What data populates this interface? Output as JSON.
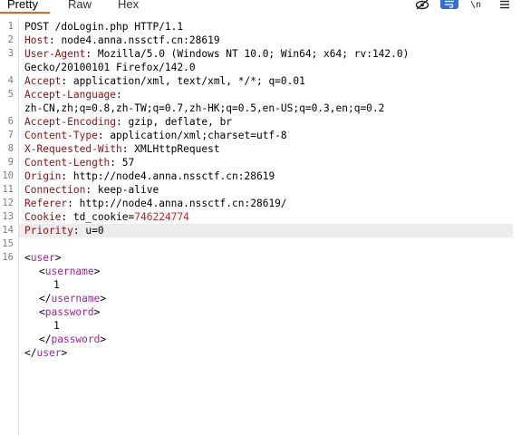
{
  "tabs": [
    {
      "label": "Pretty",
      "active": true
    },
    {
      "label": "Raw",
      "active": false
    },
    {
      "label": "Hex",
      "active": false
    }
  ],
  "toolbar_icons": [
    "eye-slash-icon",
    "wrap-icon",
    "newline-icon",
    "menu-icon"
  ],
  "line_numbers": [
    "1",
    "2",
    "3",
    "",
    "4",
    "5",
    "",
    "6",
    "7",
    "8",
    "9",
    "10",
    "11",
    "12",
    "13",
    "14",
    "15",
    "16"
  ],
  "request_line": "POST /doLogin.php HTTP/1.1",
  "headers": [
    {
      "name": "Host",
      "value": "node4.anna.nssctf.cn:28619"
    },
    {
      "name": "User-Agent",
      "value": "Mozilla/5.0 (Windows NT 10.0; Win64; x64; rv:142.0)",
      "cont": "Gecko/20100101 Firefox/142.0"
    },
    {
      "name": "Accept",
      "value": "application/xml, text/xml, */*; q=0.01"
    },
    {
      "name": "Accept-Language",
      "value": "",
      "cont": "zh-CN,zh;q=0.8,zh-TW;q=0.7,zh-HK;q=0.5,en-US;q=0.3,en;q=0.2"
    },
    {
      "name": "Accept-Encoding",
      "value": "gzip, deflate, br"
    },
    {
      "name": "Content-Type",
      "value": "application/xml;charset=utf-8"
    },
    {
      "name": "X-Requested-With",
      "value": "XMLHttpRequest"
    },
    {
      "name": "Content-Length",
      "value": "57"
    },
    {
      "name": "Origin",
      "value": "http://node4.anna.nssctf.cn:28619"
    },
    {
      "name": "Connection",
      "value": "keep-alive"
    },
    {
      "name": "Referer",
      "value": "http://node4.anna.nssctf.cn:28619/"
    },
    {
      "name": "Cookie",
      "value": "td_cookie=",
      "cookie_value": "746224774"
    },
    {
      "name": "Priority",
      "value": "u=0"
    }
  ],
  "body_xml": {
    "root": "user",
    "username_tag": "username",
    "username_value": "1",
    "password_tag": "password",
    "password_value": "1"
  },
  "colors": {
    "accent": "#e8632b",
    "header_name": "#8c1010",
    "xml_tag": "#a020a0",
    "cookie_value": "#c0282d",
    "active_tool": "#2f6fd1"
  }
}
